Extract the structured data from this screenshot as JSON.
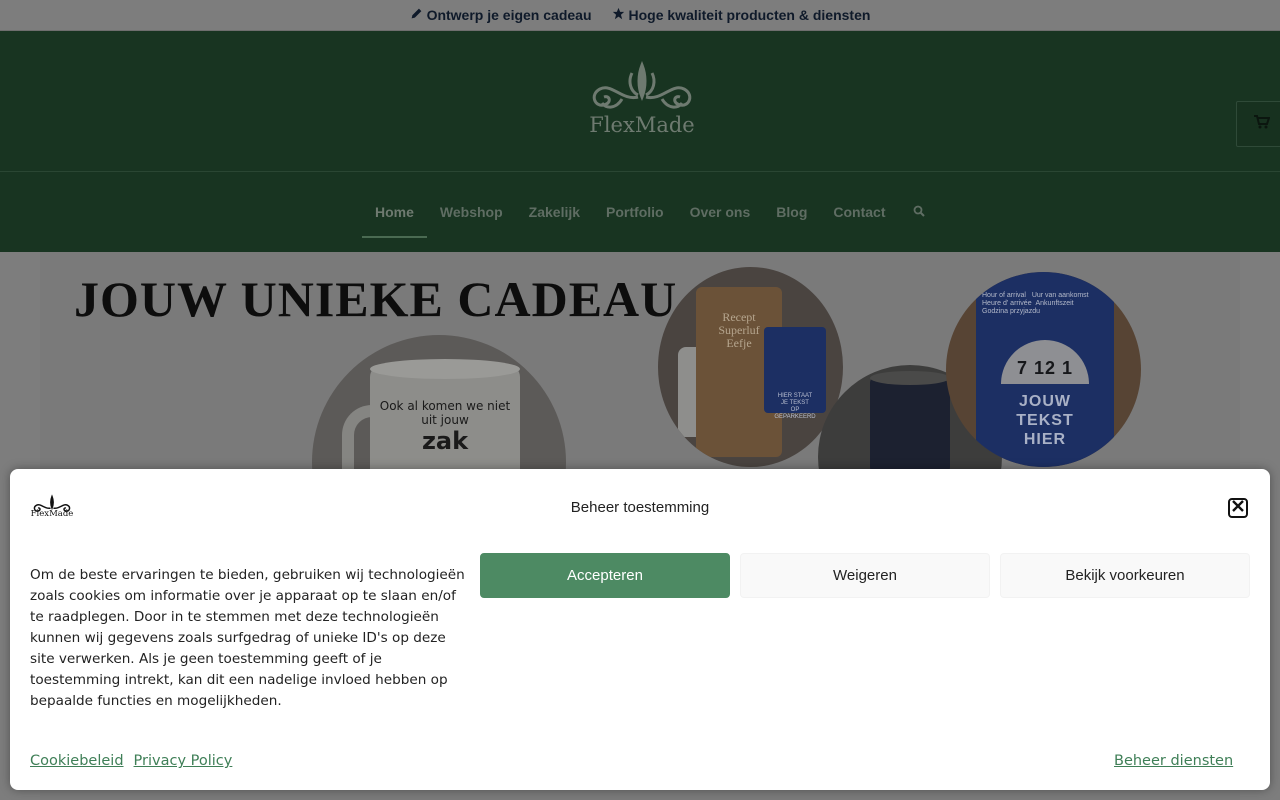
{
  "topbar": {
    "items": [
      {
        "icon": "pencil-icon",
        "label": "Ontwerp je eigen cadeau"
      },
      {
        "icon": "star-icon",
        "label": "Hoge kwaliteit producten & diensten"
      }
    ]
  },
  "header": {
    "logo_text": "FlexMade",
    "cart_icon": "cart-icon"
  },
  "nav": {
    "items": [
      "Home",
      "Webshop",
      "Zakelijk",
      "Portfolio",
      "Over ons",
      "Blog",
      "Contact"
    ],
    "active": "Home",
    "search_icon": "search-icon"
  },
  "hero": {
    "title": "JOUW UNIEKE CADEAU",
    "mug": {
      "line1": "Ook al komen we niet",
      "line2": "uit jouw",
      "big": "zak"
    },
    "board": {
      "line1": "Recept",
      "line2": "Superluf",
      "line3": "Eefje"
    },
    "disk_small": {
      "line1": "HIER STAAT",
      "line2": "JE TEKST",
      "line3": "OP",
      "line4": "GEPARKEERD"
    },
    "disk": {
      "head_left": "Hour of arrival",
      "head_right": "Uur van aankomst",
      "head_left2": "Heure d' arrivée",
      "head_right2": "Ankunftszeit",
      "head_left3": "Godzina przyjazdu",
      "number": "7 12 1",
      "line1": "JOUW",
      "line2": "TEKST",
      "line3": "HIER"
    }
  },
  "consent": {
    "logo_text": "FlexMade",
    "title": "Beheer toestemming",
    "message": "Om de beste ervaringen te bieden, gebruiken wij technologieën zoals cookies om informatie over je apparaat op te slaan en/of te raadplegen. Door in te stemmen met deze technologieën kunnen wij gegevens zoals surfgedrag of unieke ID's op deze site verwerken. Als je geen toestemming geeft of je toestemming intrekt, kan dit een nadelige invloed hebben op bepaalde functies en mogelijkheden.",
    "accept_label": "Accepteren",
    "deny_label": "Weigeren",
    "prefs_label": "Bekijk voorkeuren",
    "links": [
      "Cookiebeleid",
      "Privacy Policy"
    ],
    "manage_label": "Beheer diensten",
    "colors": {
      "accept": "#4d8a63",
      "link": "#3f7f57"
    }
  },
  "colors": {
    "header_bg": "#183421",
    "topbar_bg": "#7d7d7d"
  }
}
